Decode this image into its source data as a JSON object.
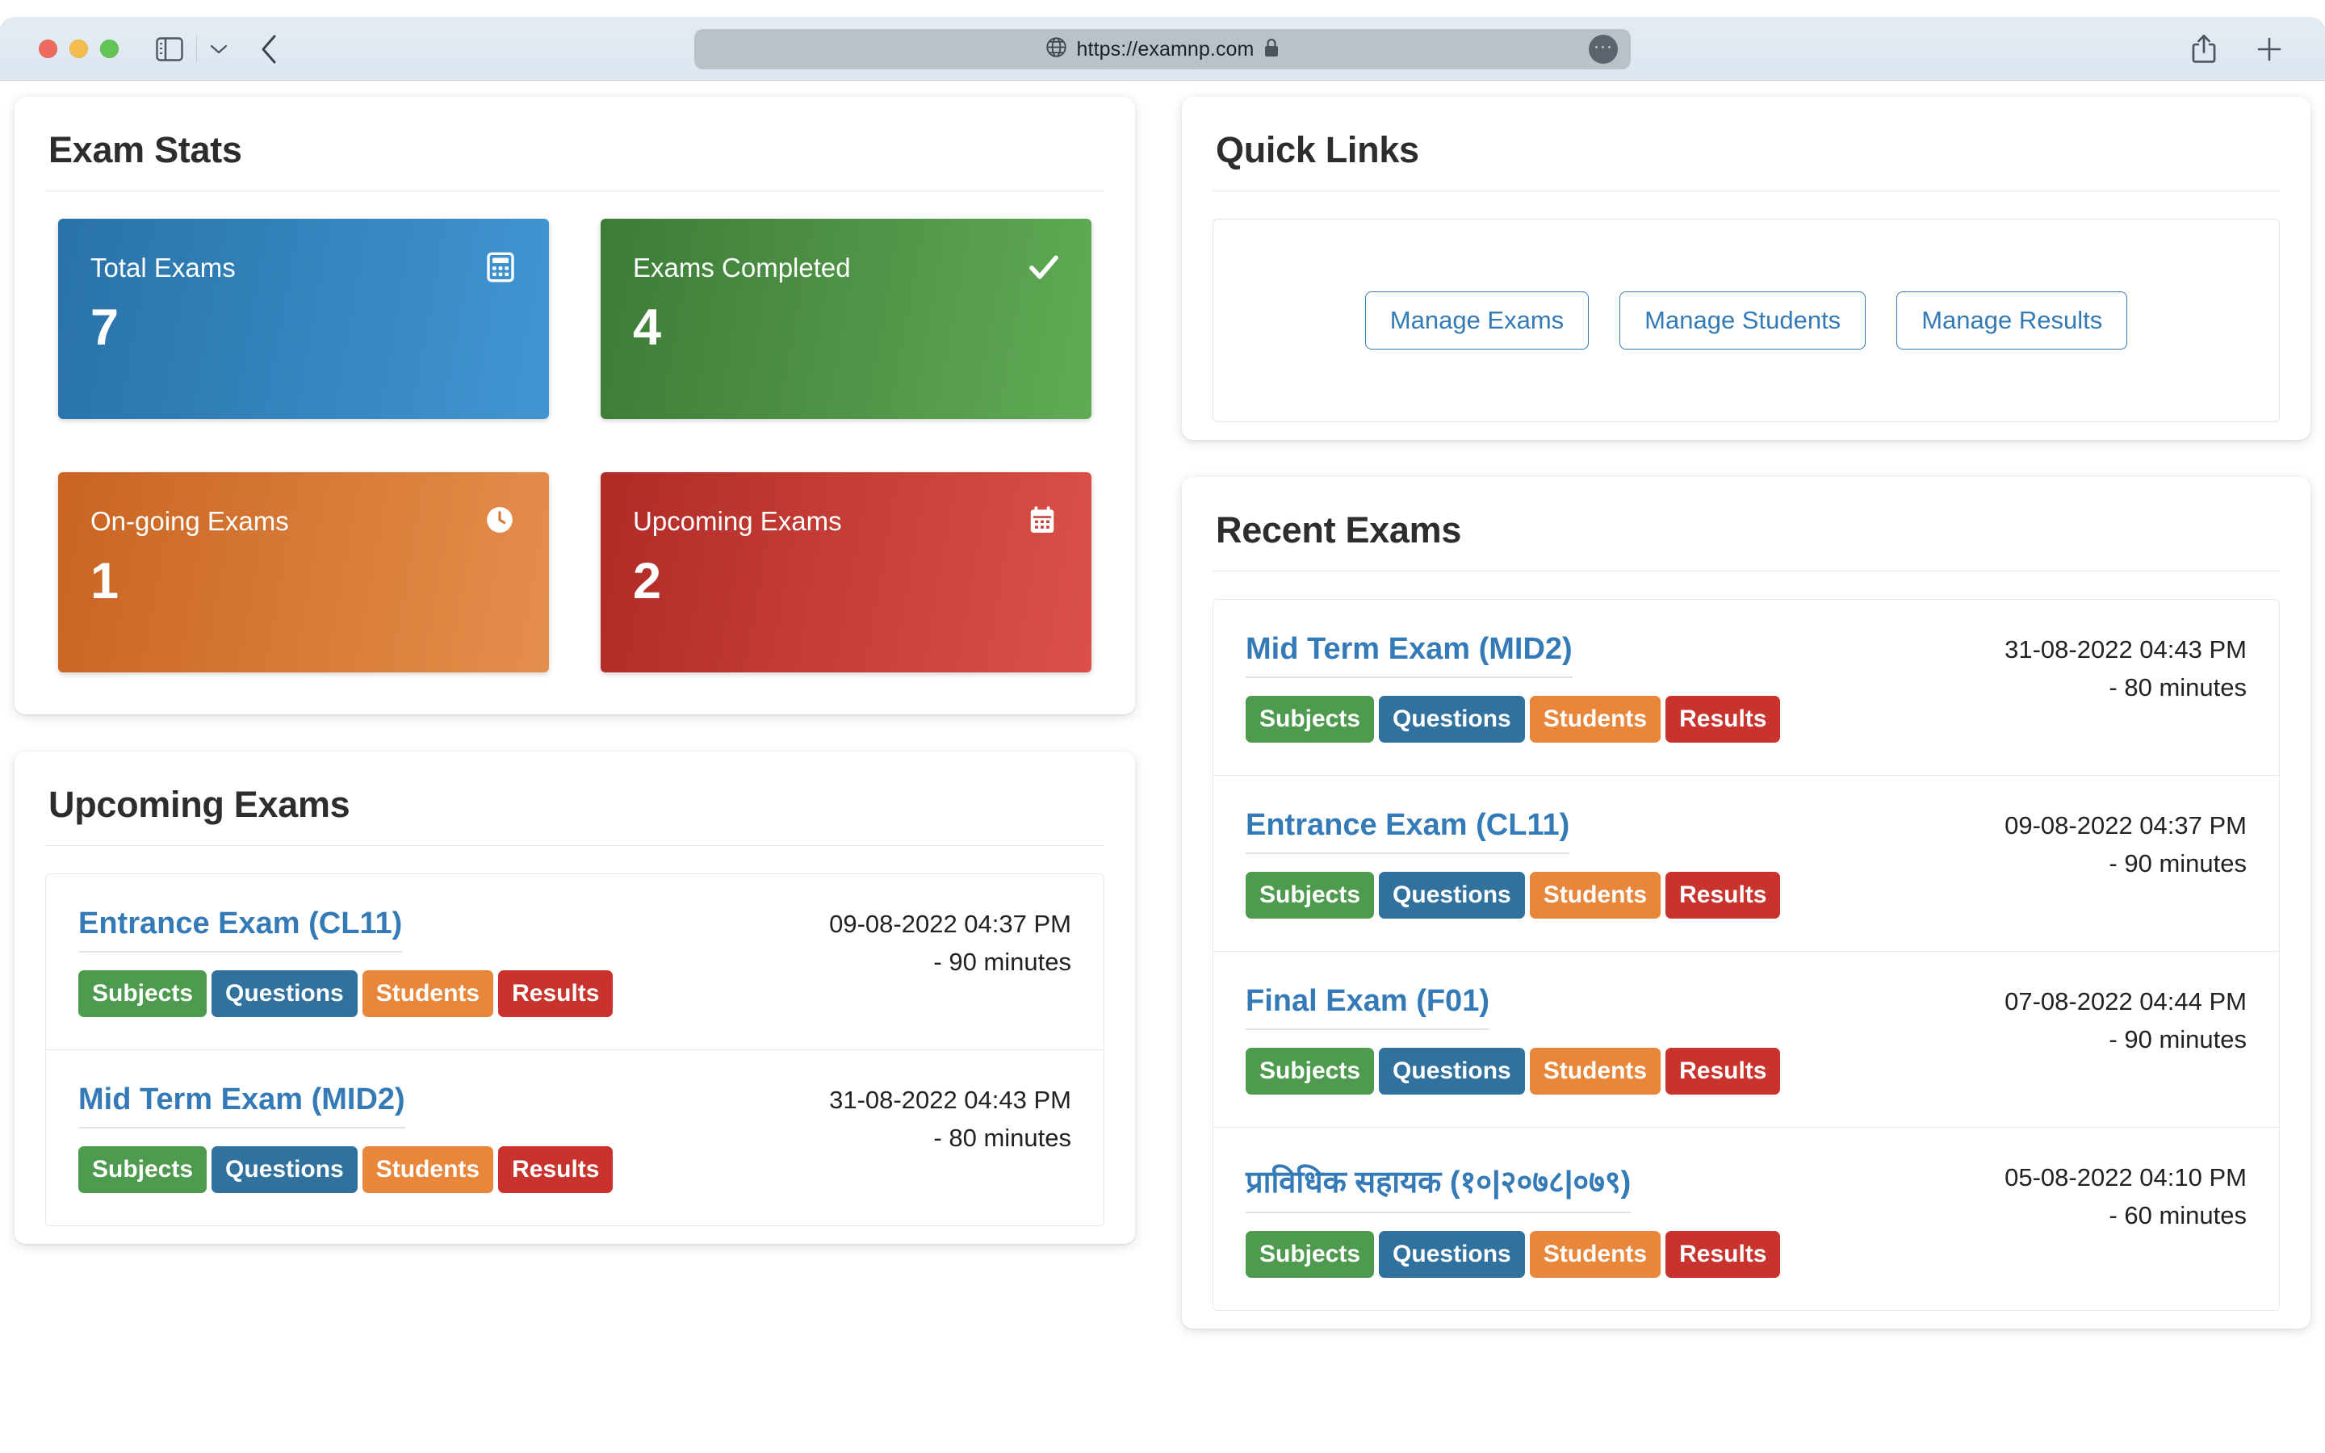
{
  "browser": {
    "url": "https://examnp.com",
    "icons": {
      "globe": "globe-icon",
      "lock": "lock-icon",
      "more": "···",
      "sidebar": "sidebar-toggle-icon",
      "caret": "chevron-down-icon",
      "back": "back-chevron-icon",
      "share": "share-icon",
      "newtab": "plus-icon"
    }
  },
  "exam_stats": {
    "title": "Exam Stats",
    "tiles": [
      {
        "label": "Total Exams",
        "value": "7",
        "color": "#3a86c0",
        "icon": "calculator-icon"
      },
      {
        "label": "Exams Completed",
        "value": "4",
        "color": "#4f9a46",
        "icon": "check-icon"
      },
      {
        "label": "On-going Exams",
        "value": "1",
        "color": "#d67a36",
        "icon": "clock-icon"
      },
      {
        "label": "Upcoming Exams",
        "value": "2",
        "color": "#c63f37",
        "icon": "calendar-icon"
      }
    ]
  },
  "quick_links": {
    "title": "Quick Links",
    "buttons": [
      {
        "label": "Manage Exams"
      },
      {
        "label": "Manage Students"
      },
      {
        "label": "Manage Results"
      }
    ]
  },
  "upcoming_exams": {
    "title": "Upcoming Exams",
    "items": [
      {
        "name": "Entrance Exam (CL11)",
        "datetime": "09-08-2022 04:37 PM",
        "duration": "- 90 minutes",
        "badges": [
          "Subjects",
          "Questions",
          "Students",
          "Results"
        ]
      },
      {
        "name": "Mid Term Exam (MID2)",
        "datetime": "31-08-2022 04:43 PM",
        "duration": "- 80 minutes",
        "badges": [
          "Subjects",
          "Questions",
          "Students",
          "Results"
        ]
      }
    ]
  },
  "recent_exams": {
    "title": "Recent Exams",
    "items": [
      {
        "name": "Mid Term Exam (MID2)",
        "datetime": "31-08-2022 04:43 PM",
        "duration": "- 80 minutes",
        "badges": [
          "Subjects",
          "Questions",
          "Students",
          "Results"
        ]
      },
      {
        "name": "Entrance Exam (CL11)",
        "datetime": "09-08-2022 04:37 PM",
        "duration": "- 90 minutes",
        "badges": [
          "Subjects",
          "Questions",
          "Students",
          "Results"
        ]
      },
      {
        "name": "Final Exam (F01)",
        "datetime": "07-08-2022 04:44 PM",
        "duration": "- 90 minutes",
        "badges": [
          "Subjects",
          "Questions",
          "Students",
          "Results"
        ]
      },
      {
        "name": "प्राविधिक सहायक (१०|२०७८|०७९)",
        "datetime": "05-08-2022 04:10 PM",
        "duration": "- 60 minutes",
        "badges": [
          "Subjects",
          "Questions",
          "Students",
          "Results"
        ]
      }
    ]
  },
  "colors": {
    "link": "#337ab7",
    "badge_subjects": "#4e9a4e",
    "badge_questions": "#31719d",
    "badge_students": "#e8873c",
    "badge_results": "#c9332e"
  }
}
